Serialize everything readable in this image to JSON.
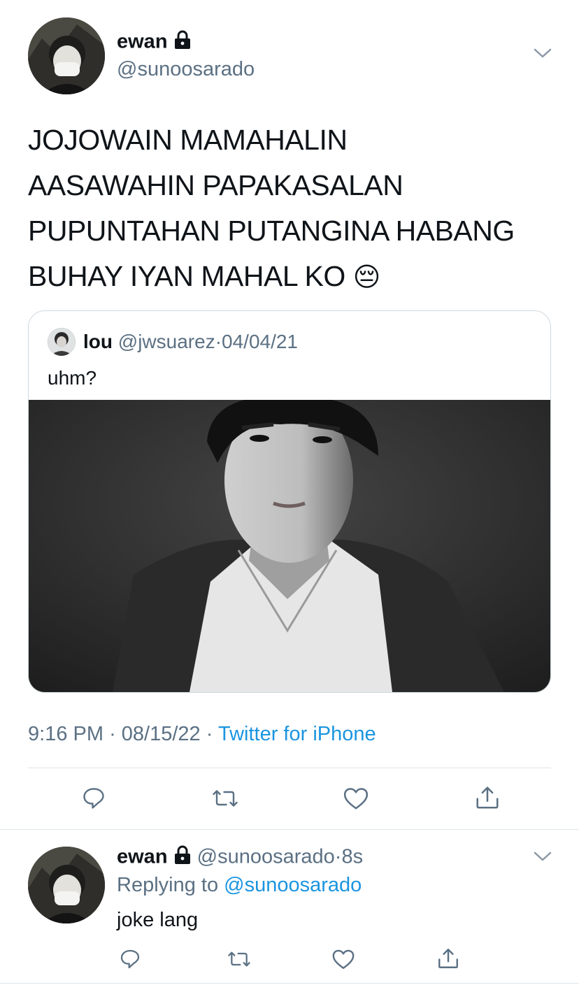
{
  "main_tweet": {
    "author_name": "ewan",
    "author_handle": "@sunoosarado",
    "text_lines": [
      "JOJOWAIN MAMAHALIN",
      "AASAWAHIN PAPAKASALAN",
      "PUPUNTAHAN PUTANGINA HABANG",
      "BUHAY IYAN MAHAL KO"
    ],
    "emoji": "😔",
    "time": "9:16 PM",
    "date": "08/15/22",
    "source": "Twitter for iPhone",
    "sep": "·"
  },
  "quoted_tweet": {
    "author_name": "lou",
    "author_handle": "@jwsuarez",
    "sep": "·",
    "date": "04/04/21",
    "text": "uhm?"
  },
  "reply": {
    "author_name": "ewan",
    "author_handle": "@sunoosarado",
    "sep": "·",
    "time": "8s",
    "replying_prefix": "Replying to",
    "replying_to": "@sunoosarado",
    "text": "joke lang"
  },
  "icons": {
    "lock": "lock-icon",
    "more": "chevron-down-icon",
    "reply": "reply-icon",
    "retweet": "retweet-icon",
    "like": "heart-icon",
    "share": "share-icon"
  },
  "colors": {
    "text": "#0f1419",
    "secondary": "#5b7083",
    "link": "#1b95e0",
    "border": "#cfd9de"
  }
}
